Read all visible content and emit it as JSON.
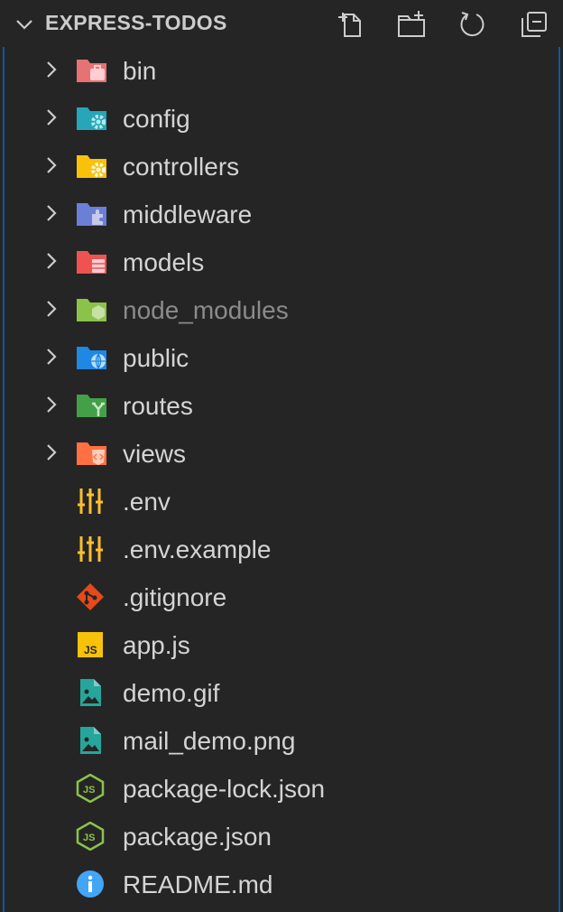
{
  "explorer": {
    "title": "EXPRESS-TODOS",
    "actions": [
      {
        "name": "new-file-icon"
      },
      {
        "name": "new-folder-icon"
      },
      {
        "name": "refresh-icon"
      },
      {
        "name": "collapse-all-icon"
      }
    ]
  },
  "tree": {
    "folders": [
      {
        "label": "bin",
        "icon": "folder-bin-icon",
        "color": "#e57373"
      },
      {
        "label": "config",
        "icon": "folder-config-icon",
        "color": "#26a6b8"
      },
      {
        "label": "controllers",
        "icon": "folder-controllers-icon",
        "color": "#f9c20a"
      },
      {
        "label": "middleware",
        "icon": "folder-middleware-icon",
        "color": "#6b7fd7"
      },
      {
        "label": "models",
        "icon": "folder-models-icon",
        "color": "#ef5350"
      },
      {
        "label": "node_modules",
        "icon": "folder-node-icon",
        "color": "#8bc34a"
      },
      {
        "label": "public",
        "icon": "folder-public-icon",
        "color": "#1e88e5"
      },
      {
        "label": "routes",
        "icon": "folder-routes-icon",
        "color": "#43a047"
      },
      {
        "label": "views",
        "icon": "folder-views-icon",
        "color": "#ff7043"
      }
    ],
    "files": [
      {
        "label": ".env",
        "icon": "env-file-icon"
      },
      {
        "label": ".env.example",
        "icon": "env-file-icon"
      },
      {
        "label": ".gitignore",
        "icon": "git-icon"
      },
      {
        "label": "app.js",
        "icon": "javascript-icon"
      },
      {
        "label": "demo.gif",
        "icon": "image-icon"
      },
      {
        "label": "mail_demo.png",
        "icon": "image-icon"
      },
      {
        "label": "package-lock.json",
        "icon": "nodejs-icon"
      },
      {
        "label": "package.json",
        "icon": "nodejs-icon"
      },
      {
        "label": "README.md",
        "icon": "info-icon"
      }
    ]
  }
}
